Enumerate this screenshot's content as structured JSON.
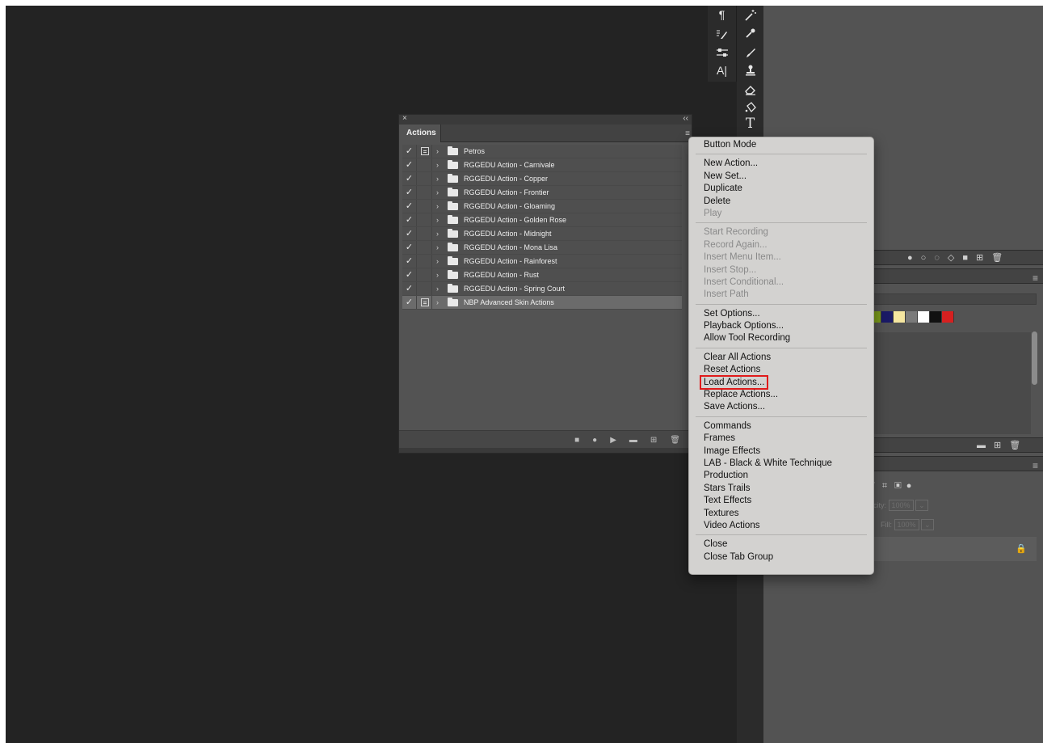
{
  "tools_left": [
    "¶",
    "brush-settings",
    "sliders",
    "A|"
  ],
  "tools_right": [
    "magic-wand",
    "eyedropper",
    "brush",
    "stamp",
    "eraser",
    "pen",
    "T"
  ],
  "actions_panel": {
    "tab_label": "Actions",
    "close_glyph": "×",
    "collapse_glyph": "‹‹",
    "rows": [
      {
        "name": "Petros",
        "dialog": true,
        "selected": false
      },
      {
        "name": "RGGEDU Action - Carnivale",
        "dialog": false,
        "selected": false
      },
      {
        "name": "RGGEDU Action - Copper",
        "dialog": false,
        "selected": false
      },
      {
        "name": "RGGEDU Action - Frontier",
        "dialog": false,
        "selected": false
      },
      {
        "name": "RGGEDU Action - Gloaming",
        "dialog": false,
        "selected": false
      },
      {
        "name": "RGGEDU Action - Golden Rose",
        "dialog": false,
        "selected": false
      },
      {
        "name": "RGGEDU Action - Midnight",
        "dialog": false,
        "selected": false
      },
      {
        "name": "RGGEDU Action - Mona Lisa",
        "dialog": false,
        "selected": false
      },
      {
        "name": "RGGEDU Action - Rainforest",
        "dialog": false,
        "selected": false
      },
      {
        "name": "RGGEDU Action - Rust",
        "dialog": false,
        "selected": false
      },
      {
        "name": "RGGEDU Action - Spring Court",
        "dialog": false,
        "selected": false
      },
      {
        "name": "NBP Advanced Skin Actions",
        "dialog": true,
        "selected": true
      }
    ]
  },
  "menu": {
    "groups": [
      [
        {
          "label": "Button Mode",
          "enabled": true
        }
      ],
      [
        {
          "label": "New Action...",
          "enabled": true
        },
        {
          "label": "New Set...",
          "enabled": true
        },
        {
          "label": "Duplicate",
          "enabled": true
        },
        {
          "label": "Delete",
          "enabled": true
        },
        {
          "label": "Play",
          "enabled": false
        }
      ],
      [
        {
          "label": "Start Recording",
          "enabled": false
        },
        {
          "label": "Record Again...",
          "enabled": false
        },
        {
          "label": "Insert Menu Item...",
          "enabled": false
        },
        {
          "label": "Insert Stop...",
          "enabled": false
        },
        {
          "label": "Insert Conditional...",
          "enabled": false
        },
        {
          "label": "Insert Path",
          "enabled": false
        }
      ],
      [
        {
          "label": "Set Options...",
          "enabled": true
        },
        {
          "label": "Playback Options...",
          "enabled": true
        },
        {
          "label": "Allow Tool Recording",
          "enabled": true
        }
      ],
      [
        {
          "label": "Clear All Actions",
          "enabled": true
        },
        {
          "label": "Reset Actions",
          "enabled": true
        },
        {
          "label": "Load Actions...",
          "enabled": true,
          "highlighted": true
        },
        {
          "label": "Replace Actions...",
          "enabled": true
        },
        {
          "label": "Save Actions...",
          "enabled": true
        }
      ],
      [
        {
          "label": "Commands",
          "enabled": true
        },
        {
          "label": "Frames",
          "enabled": true
        },
        {
          "label": "Image Effects",
          "enabled": true
        },
        {
          "label": "LAB - Black & White Technique",
          "enabled": true
        },
        {
          "label": "Production",
          "enabled": true
        },
        {
          "label": "Stars Trails",
          "enabled": true
        },
        {
          "label": "Text Effects",
          "enabled": true
        },
        {
          "label": "Textures",
          "enabled": true
        },
        {
          "label": "Video Actions",
          "enabled": true
        }
      ],
      [
        {
          "label": "Close",
          "enabled": true
        },
        {
          "label": "Close Tab Group",
          "enabled": true
        }
      ]
    ]
  },
  "layers_panel": {
    "opacity_label": "acity:",
    "opacity_value": "100%",
    "fill_label": "Fill:",
    "fill_value": "100%"
  },
  "swatch_colors": [
    "#7a9a1a",
    "#1a1a66",
    "#f5e6a0",
    "#7a7a7a",
    "#ffffff",
    "#111111",
    "#d62020"
  ],
  "colors": {
    "workspace": "#232323",
    "menu_bg": "#d3d2d0",
    "highlight_outline": "#e01a1a"
  }
}
